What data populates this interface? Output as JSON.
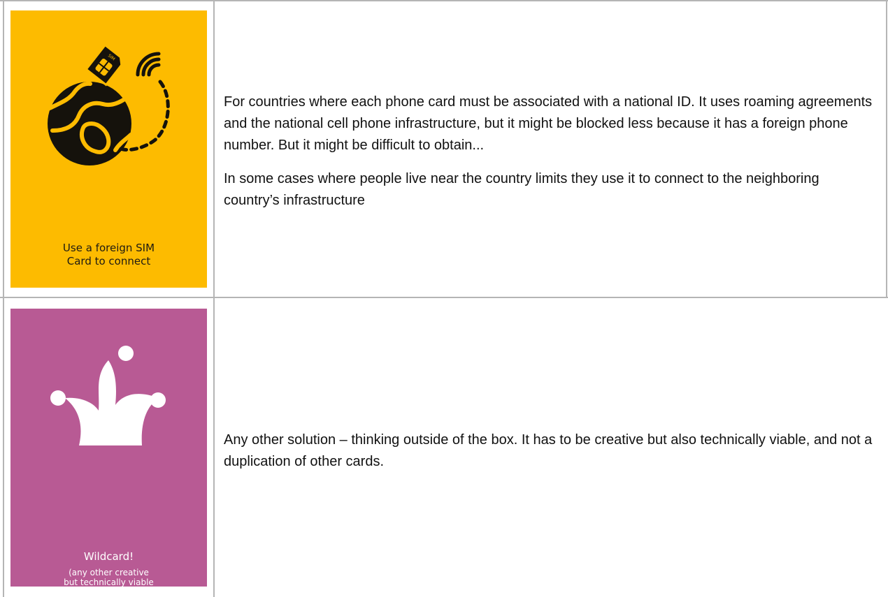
{
  "rows": [
    {
      "card": {
        "title": "Use a foreign SIM\nCard to connect",
        "color": "#fdbb00",
        "icon": "globe-sim-card-icon",
        "sim_label": "SIM"
      },
      "paragraphs": [
        "For countries where each phone card must be associated with a national ID. It uses roaming agreements and the national cell phone infrastructure, but it might be blocked less because it has a foreign phone number. But it might be difficult to obtain...",
        "In some cases where people live near the country limits they use it to connect to the neighboring country’s infrastructure"
      ]
    },
    {
      "card": {
        "title": "Wildcard!",
        "subtitle": "(any other creative\nbut technically viable\nsolution you can think of)",
        "color": "#b85a94",
        "icon": "jester-hat-icon"
      },
      "paragraphs": [
        "Any other solution – thinking outside of the box. It has to be creative but also technically viable, and not a duplication of other cards."
      ]
    }
  ]
}
